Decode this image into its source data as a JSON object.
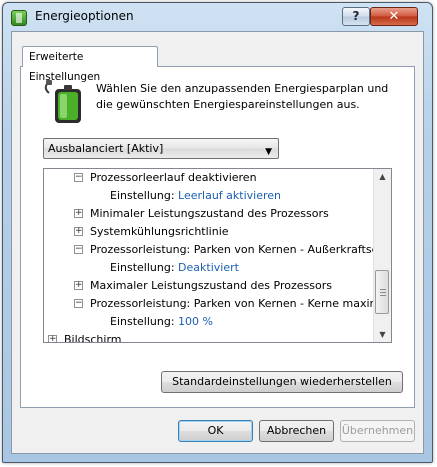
{
  "window": {
    "title": "Energieoptionen",
    "help_label": "?",
    "close_label": "✕"
  },
  "tab": {
    "label": "Erweiterte Einstellungen"
  },
  "intro_text": "Wählen Sie den anzupassenden Energiesparplan und die gewünschten Energiespareinstellungen aus.",
  "plan_select": {
    "value": "Ausbalanciert [Aktiv]"
  },
  "tree": {
    "items": [
      {
        "label": "Prozessorleerlauf deaktivieren",
        "expander": "⊟"
      },
      {
        "setting_label": "Einstellung:",
        "setting_value": "Leerlauf aktivieren"
      },
      {
        "label": "Minimaler Leistungszustand des Prozessors",
        "expander": "⊞"
      },
      {
        "label": "Systemkühlungsrichtlinie",
        "expander": "⊞"
      },
      {
        "label": "Prozessorleistung: Parken von Kernen - Außerkraftsetzu",
        "expander": "⊟"
      },
      {
        "setting_label": "Einstellung:",
        "setting_value": "Deaktiviert"
      },
      {
        "label": "Maximaler Leistungszustand des Prozessors",
        "expander": "⊞"
      },
      {
        "label": "Prozessorleistung: Parken von Kernen - Kerne maximal",
        "expander": "⊟"
      },
      {
        "setting_label": "Einstellung:",
        "setting_value": "100 %"
      },
      {
        "label": "Bildschirm",
        "expander": "⊞"
      }
    ]
  },
  "buttons": {
    "restore": "Standardeinstellungen wiederherstellen",
    "ok": "OK",
    "cancel": "Abbrechen",
    "apply": "Übernehmen"
  },
  "colors": {
    "setting_value": "#1c5fb0",
    "titlebar": "#b6d0e8",
    "close_button": "#c8452a"
  }
}
